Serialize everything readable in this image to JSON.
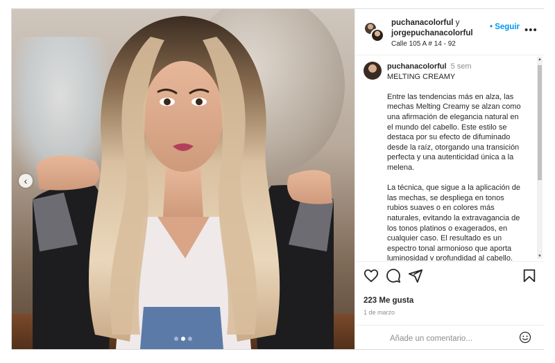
{
  "header": {
    "user1": "puchanacolorful",
    "conjunction": "y",
    "user2": "jorgepuchanacolorful",
    "location": "Calle 105 A # 14 - 92",
    "follow_label": "• Seguir",
    "more_label": "•••"
  },
  "caption": {
    "username": "puchanacolorful",
    "time": "5 sem",
    "title": "MELTING CREAMY",
    "paragraph1": "Entre las tendencias más en alza, las mechas Melting Creamy se alzan como una afirmación de elegancia natural en el mundo del cabello. Este estilo se destaca por su efecto de difuminado desde la raíz, otorgando una transición perfecta y una autenticidad única a la melena.",
    "paragraph2": "La técnica, que sigue a la aplicación de las mechas, se despliega en tonos rubios suaves o en colores más naturales, evitando la extravagancia de los tonos platinos o exagerados, en cualquier caso. El resultado es un espectro tonal armonioso que aporta luminosidad y profundidad al cabello."
  },
  "actions": {
    "icons": [
      "heart-icon",
      "comment-icon",
      "share-icon",
      "save-icon"
    ],
    "likes": "223 Me gusta",
    "date": "1 de marzo"
  },
  "comment": {
    "placeholder": "Añade un comentario...",
    "emoji_icon": "emoji-icon"
  },
  "carousel": {
    "prev_icon": "chevron-left-icon",
    "total_slides": 3,
    "active_slide": 2
  },
  "colors": {
    "accent": "#0095f6",
    "border": "#dbdbdb",
    "muted": "#8e8e8e"
  }
}
